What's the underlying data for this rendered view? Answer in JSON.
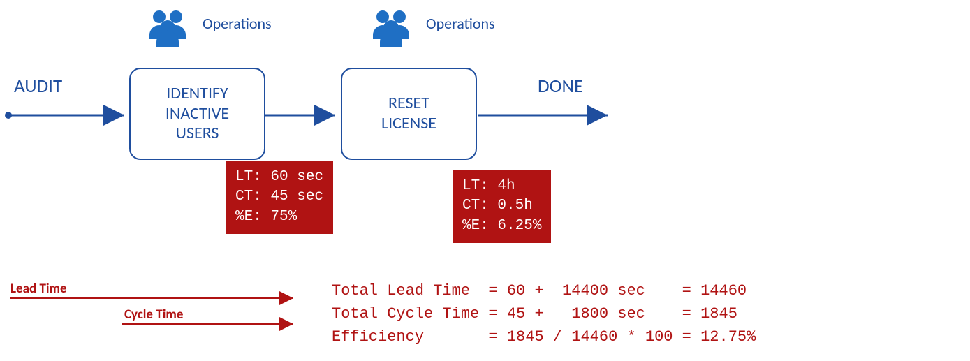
{
  "start_label": "AUDIT",
  "end_label": "DONE",
  "role_labels": {
    "ops1": "Operations",
    "ops2": "Operations"
  },
  "boxes": {
    "identify": "IDENTIFY\nINACTIVE\nUSERS",
    "reset": "RESET\nLICENSE"
  },
  "metrics": {
    "identify": "LT: 60 sec\nCT: 45 sec\n%E: 75%",
    "reset": "LT: 4h\nCT: 0.5h\n%E: 6.25%"
  },
  "legend": {
    "lead": "Lead Time",
    "cycle": "Cycle Time"
  },
  "totals": "Total Lead Time  = 60 +  14400 sec    = 14460\nTotal Cycle Time = 45 +   1800 sec    = 1845\nEfficiency       = 1845 / 14460 * 100 = 12.75%",
  "chart_data": {
    "type": "table",
    "title": "Value Stream Map Metrics",
    "steps": [
      {
        "name": "IDENTIFY INACTIVE USERS",
        "role": "Operations",
        "lead_time_sec": 60,
        "cycle_time_sec": 45,
        "efficiency_pct": 75
      },
      {
        "name": "RESET LICENSE",
        "role": "Operations",
        "lead_time_sec": 14400,
        "cycle_time_sec": 1800,
        "efficiency_pct": 6.25
      }
    ],
    "totals": {
      "lead_time_sec": 14460,
      "cycle_time_sec": 1845,
      "efficiency_pct": 12.75
    }
  }
}
